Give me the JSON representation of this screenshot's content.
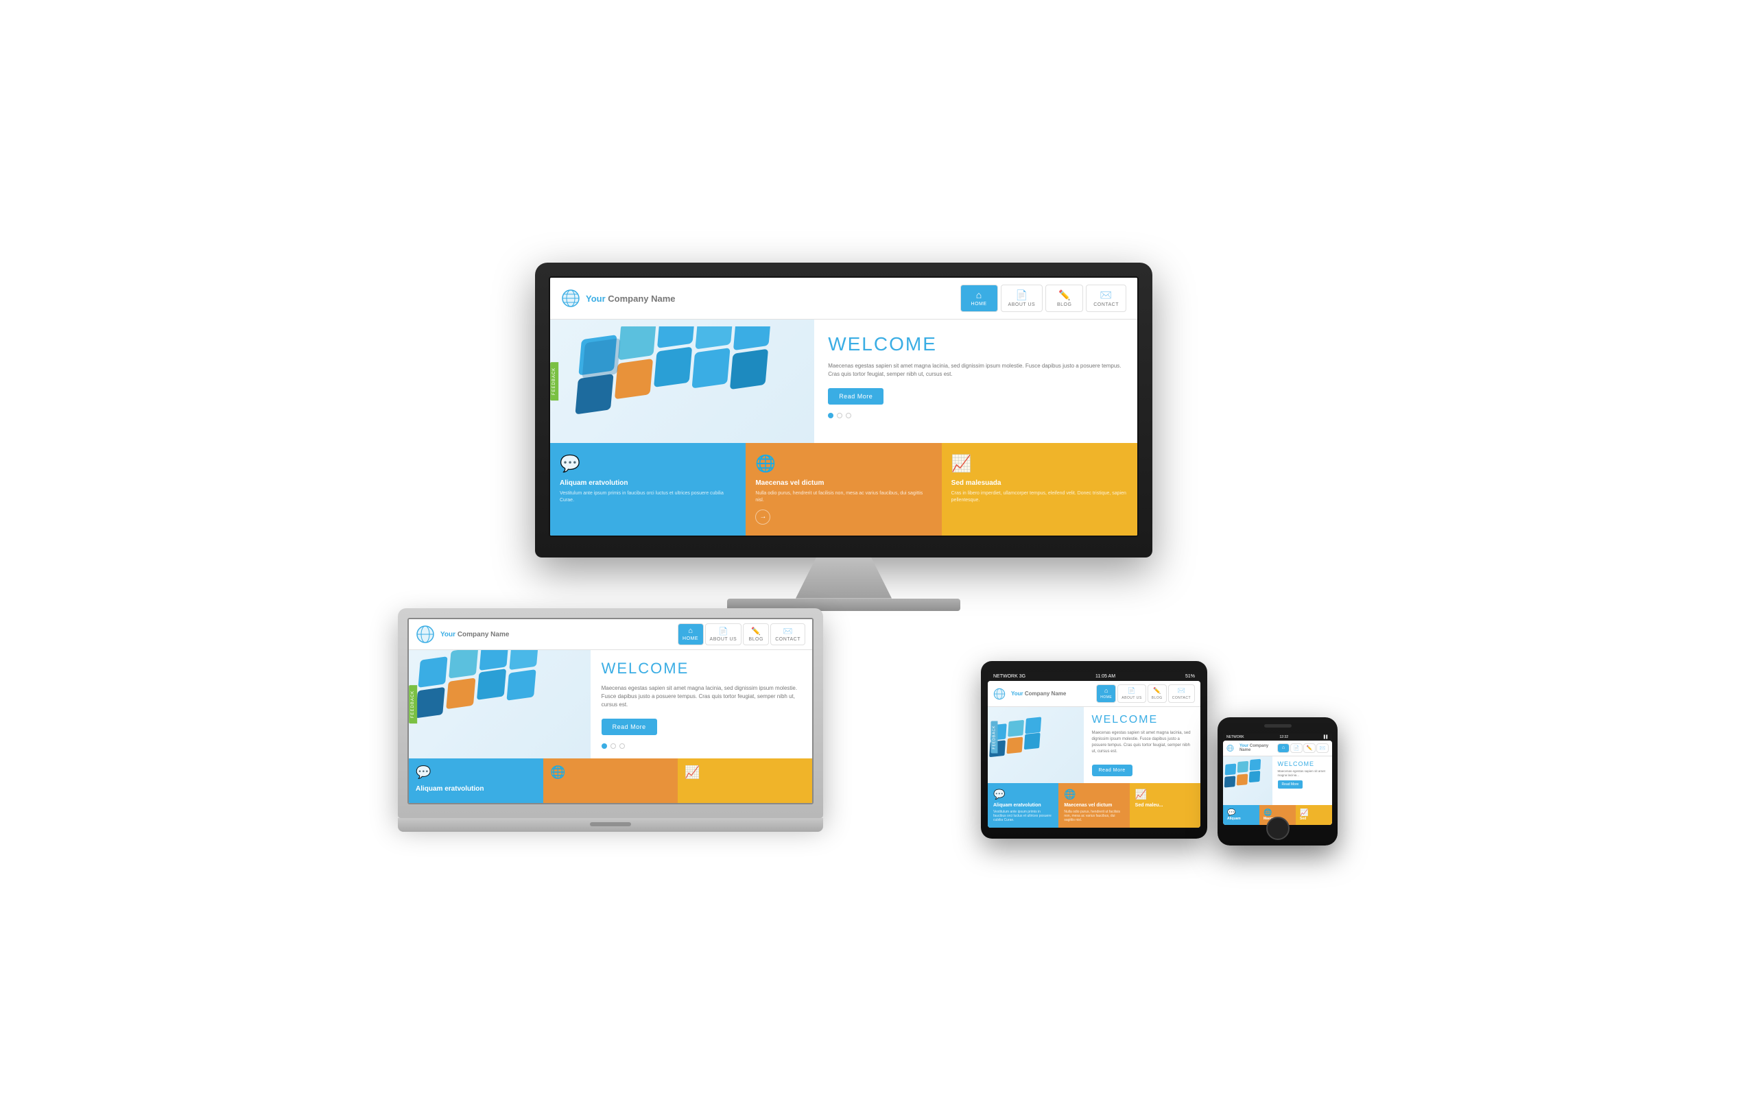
{
  "monitor": {
    "label": "desktop-monitor"
  },
  "laptop": {
    "label": "laptop-computer"
  },
  "tablet": {
    "label": "tablet-device",
    "status_bar": {
      "network": "NETWORK 3G",
      "time": "11:05 AM",
      "battery": "51%"
    }
  },
  "phone": {
    "label": "mobile-phone",
    "status_bar": {
      "network": "NETWORK",
      "time": "12:32",
      "battery": "..."
    }
  },
  "website": {
    "logo_text_1": "Your",
    "logo_text_2": "Company Name",
    "nav": {
      "home": "HOME",
      "about": "ABOUT US",
      "blog": "BLOG",
      "contact": "CONTACT"
    },
    "hero": {
      "title": "WELCOME",
      "text": "Maecenas egestas sapien sit amet magna lacinia, sed dignissim ipsum molestie. Fusce dapibus justo a posuere tempus. Cras quis tortor feugiat, semper nibh ut, cursus est.",
      "button": "Read More",
      "feedback": "FEEDBACK"
    },
    "features": [
      {
        "title": "Aliquam eratvolution",
        "text": "Vestitulum ante ipsum primis in faucibus orci luctus et ultrices posuere cubilia Curae.",
        "color": "blue",
        "icon": "💬"
      },
      {
        "title": "Maecenas vel dictum",
        "text": "Nulla odio purus, hendrerit ut facilisis non, mesa ac varius faucibus, dui sagittis nisl.",
        "color": "orange",
        "icon": "🌐"
      },
      {
        "title": "Sed malesuada",
        "text": "Cras in libero imperdiet, ullamcorper tempus, eleifend velit. Donec tristique, sapien pellentesque.",
        "color": "yellow",
        "icon": "📈"
      }
    ]
  }
}
